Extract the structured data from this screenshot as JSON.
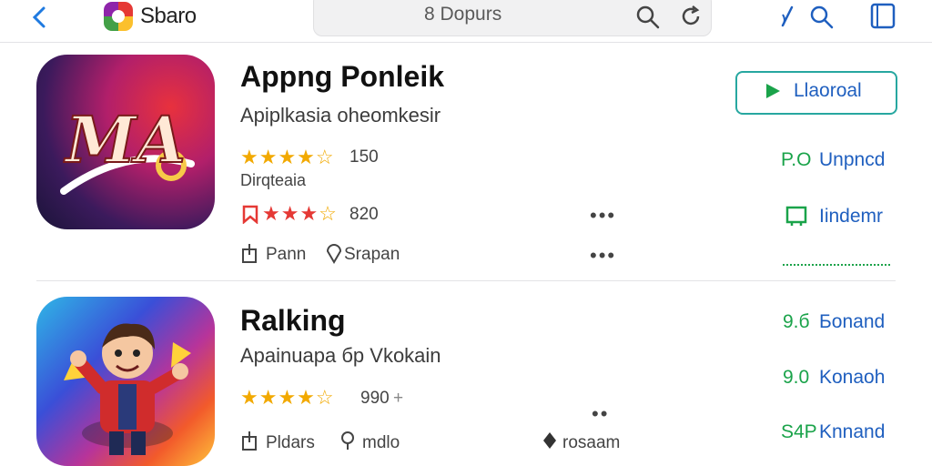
{
  "topbar": {
    "brand_name": "Sbaro",
    "search_text": "8 Dopurs"
  },
  "apps": [
    {
      "title": "Appng Ponleik",
      "subtitle": "Apiplkasia oheomkesir",
      "rating_count": "150",
      "rating_label": "Dirqteaia",
      "rating2_count": "820",
      "meta_left": "Pann",
      "meta_right": "Srapan",
      "icon_text": "MA",
      "action_install": "Llaoroal",
      "stat1_value": "P.O",
      "stat1_label": "Unpncd",
      "stat2_label": "Iindemr"
    },
    {
      "title": "Ralking",
      "subtitle": "Apainuapa бр Vkokain",
      "rating_count": "990",
      "meta_left": "Pldars",
      "meta_mid": "mdlo",
      "meta_right": "rosaam",
      "stat1_value": "9.б",
      "stat1_label": "Бonand",
      "stat2_value": "9.0",
      "stat2_label": "Konaoh",
      "stat3_value": "S4P",
      "stat3_label": "Knnand"
    }
  ],
  "colors": {
    "accent_blue": "#1f5fbf",
    "accent_green": "#1aa34a",
    "star": "#f2a900"
  }
}
